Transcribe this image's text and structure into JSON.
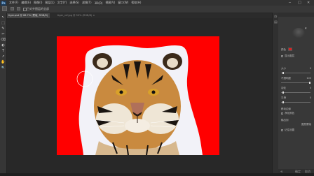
{
  "app": {
    "logo": "Ps",
    "menu": [
      "文件(F)",
      "编辑(E)",
      "图像(I)",
      "图层(L)",
      "文字(Y)",
      "选择(S)",
      "滤镜(T)",
      "3D(D)",
      "视图(V)",
      "窗口(W)",
      "帮助(H)"
    ],
    "window_controls": [
      "─",
      "□",
      "✕"
    ]
  },
  "options_bar": {
    "checkbox_label": "已对齐图层的全部"
  },
  "document_tabs": [
    {
      "label": "tiger.psd @ 66.7% (蒙版, RGB/8)",
      "active": true
    },
    {
      "label": "tiger_ref.jpg @ 50% (RGB/8) ×",
      "active": false
    }
  ],
  "tools": [
    "↖",
    "⬚",
    "✎",
    "✂",
    "⌫",
    "◐",
    "T",
    "↗",
    "✋",
    "🔍"
  ],
  "canvas": {
    "background_color": "#ff0000",
    "mask_color": "#f2f2f8"
  },
  "properties_panel": {
    "sections": [
      {
        "label": "颜色",
        "value": ""
      },
      {
        "label": "显示图层",
        "value": ""
      },
      {
        "label": "大小",
        "value": "0"
      },
      {
        "label": "不透明度",
        "value": "100"
      },
      {
        "label": "羽化",
        "value": "0"
      },
      {
        "label": "平滑",
        "value": "0"
      },
      {
        "label": "移动边缘",
        "value": ""
      },
      {
        "label": "净化颜色",
        "value": ""
      },
      {
        "label": "输出到",
        "value": "图层蒙版"
      },
      {
        "label": "记住设置",
        "value": ""
      }
    ],
    "footer_left": "⟲",
    "footer_ok": "确定",
    "footer_cancel": "取消"
  }
}
